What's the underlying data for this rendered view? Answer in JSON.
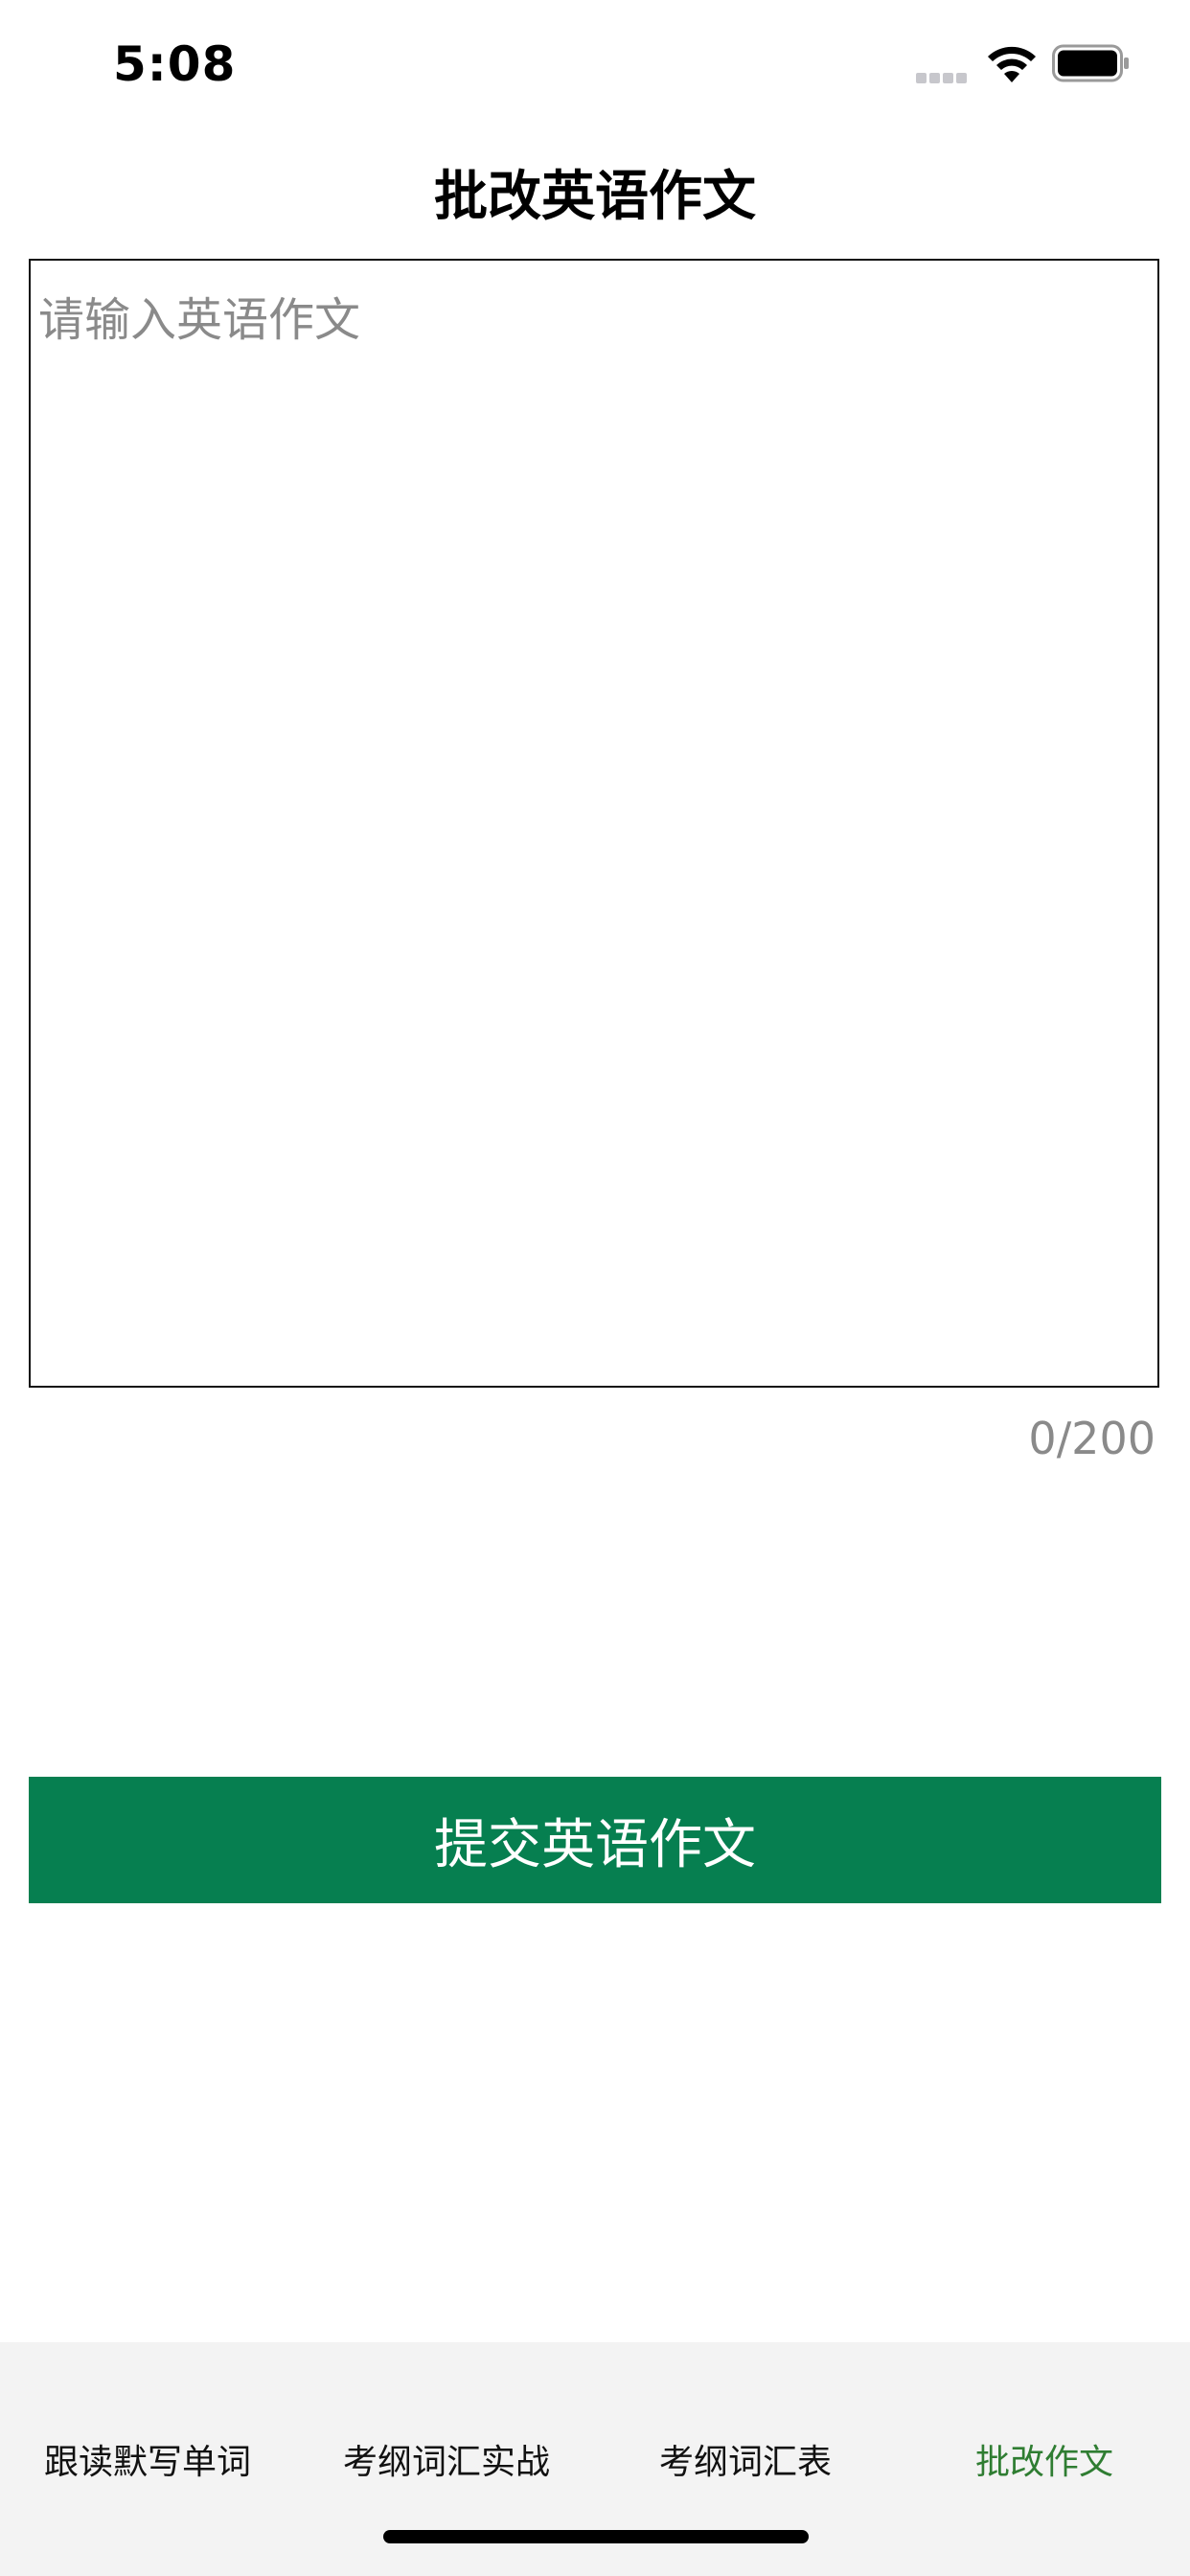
{
  "status_bar": {
    "time": "5:08"
  },
  "nav": {
    "title": "批改英语作文"
  },
  "essay": {
    "value": "",
    "placeholder": "请输入英语作文",
    "counter": "0/200"
  },
  "submit": {
    "label": "提交英语作文",
    "color": "#067f50"
  },
  "tabs": [
    {
      "label": "跟读默写单词",
      "active": false
    },
    {
      "label": "考纲词汇实战",
      "active": false
    },
    {
      "label": "考纲词汇表",
      "active": false
    },
    {
      "label": "批改作文",
      "active": true
    }
  ],
  "colors": {
    "accent": "#067f50",
    "active_tab": "#2f7d32",
    "tab_bar_bg": "#f3f3f3"
  }
}
